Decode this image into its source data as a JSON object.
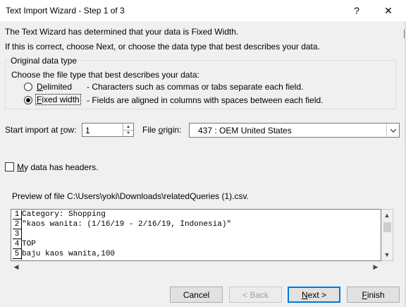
{
  "window": {
    "title": "Text Import Wizard - Step 1 of 3",
    "help_label": "?",
    "close_label": "✕"
  },
  "intro": {
    "line1": "The Text Wizard has determined that your data is Fixed Width.",
    "line2": "If this is correct, choose Next, or choose the data type that best describes your data."
  },
  "original_data_type": {
    "group_title": "Original data type",
    "prompt": "Choose the file type that best describes your data:",
    "options": [
      {
        "label_pre": "",
        "label_key": "D",
        "label_post": "elimited",
        "description": "- Characters such as commas or tabs separate each field.",
        "selected": false
      },
      {
        "label_pre": "",
        "label_key": "F",
        "label_post": "ixed width",
        "description": "- Fields are aligned in columns with spaces between each field.",
        "selected": true
      }
    ]
  },
  "start_import": {
    "label_pre": "Start import at ",
    "label_key": "r",
    "label_post": "ow:",
    "value": "1"
  },
  "file_origin": {
    "label_pre": "File ",
    "label_key": "o",
    "label_post": "rigin:",
    "value": "437 : OEM United States"
  },
  "headers_checkbox": {
    "label_key": "M",
    "label_post": "y data has headers.",
    "checked": false
  },
  "preview": {
    "label": "Preview of file C:\\Users\\yoki\\Downloads\\relatedQueries (1).csv.",
    "rows": [
      {
        "num": "1",
        "text": "Category: Shopping"
      },
      {
        "num": "2",
        "text": "\"kaos wanita: (1/16/19 - 2/16/19, Indonesia)\""
      },
      {
        "num": "3",
        "text": ""
      },
      {
        "num": "4",
        "text": "TOP"
      },
      {
        "num": "5",
        "text": "baju kaos wanita,100"
      }
    ]
  },
  "buttons": {
    "cancel": "Cancel",
    "back": "< Back",
    "next_pre": "",
    "next_key": "N",
    "next_post": "ext >",
    "finish_key": "F",
    "finish_post": "inish"
  },
  "icons": {
    "spin_up": "▲",
    "spin_down": "▼",
    "dropdown": "chevron-down-icon",
    "scroll_up": "▲",
    "scroll_down": "▼",
    "scroll_left": "◀",
    "scroll_right": "▶"
  }
}
